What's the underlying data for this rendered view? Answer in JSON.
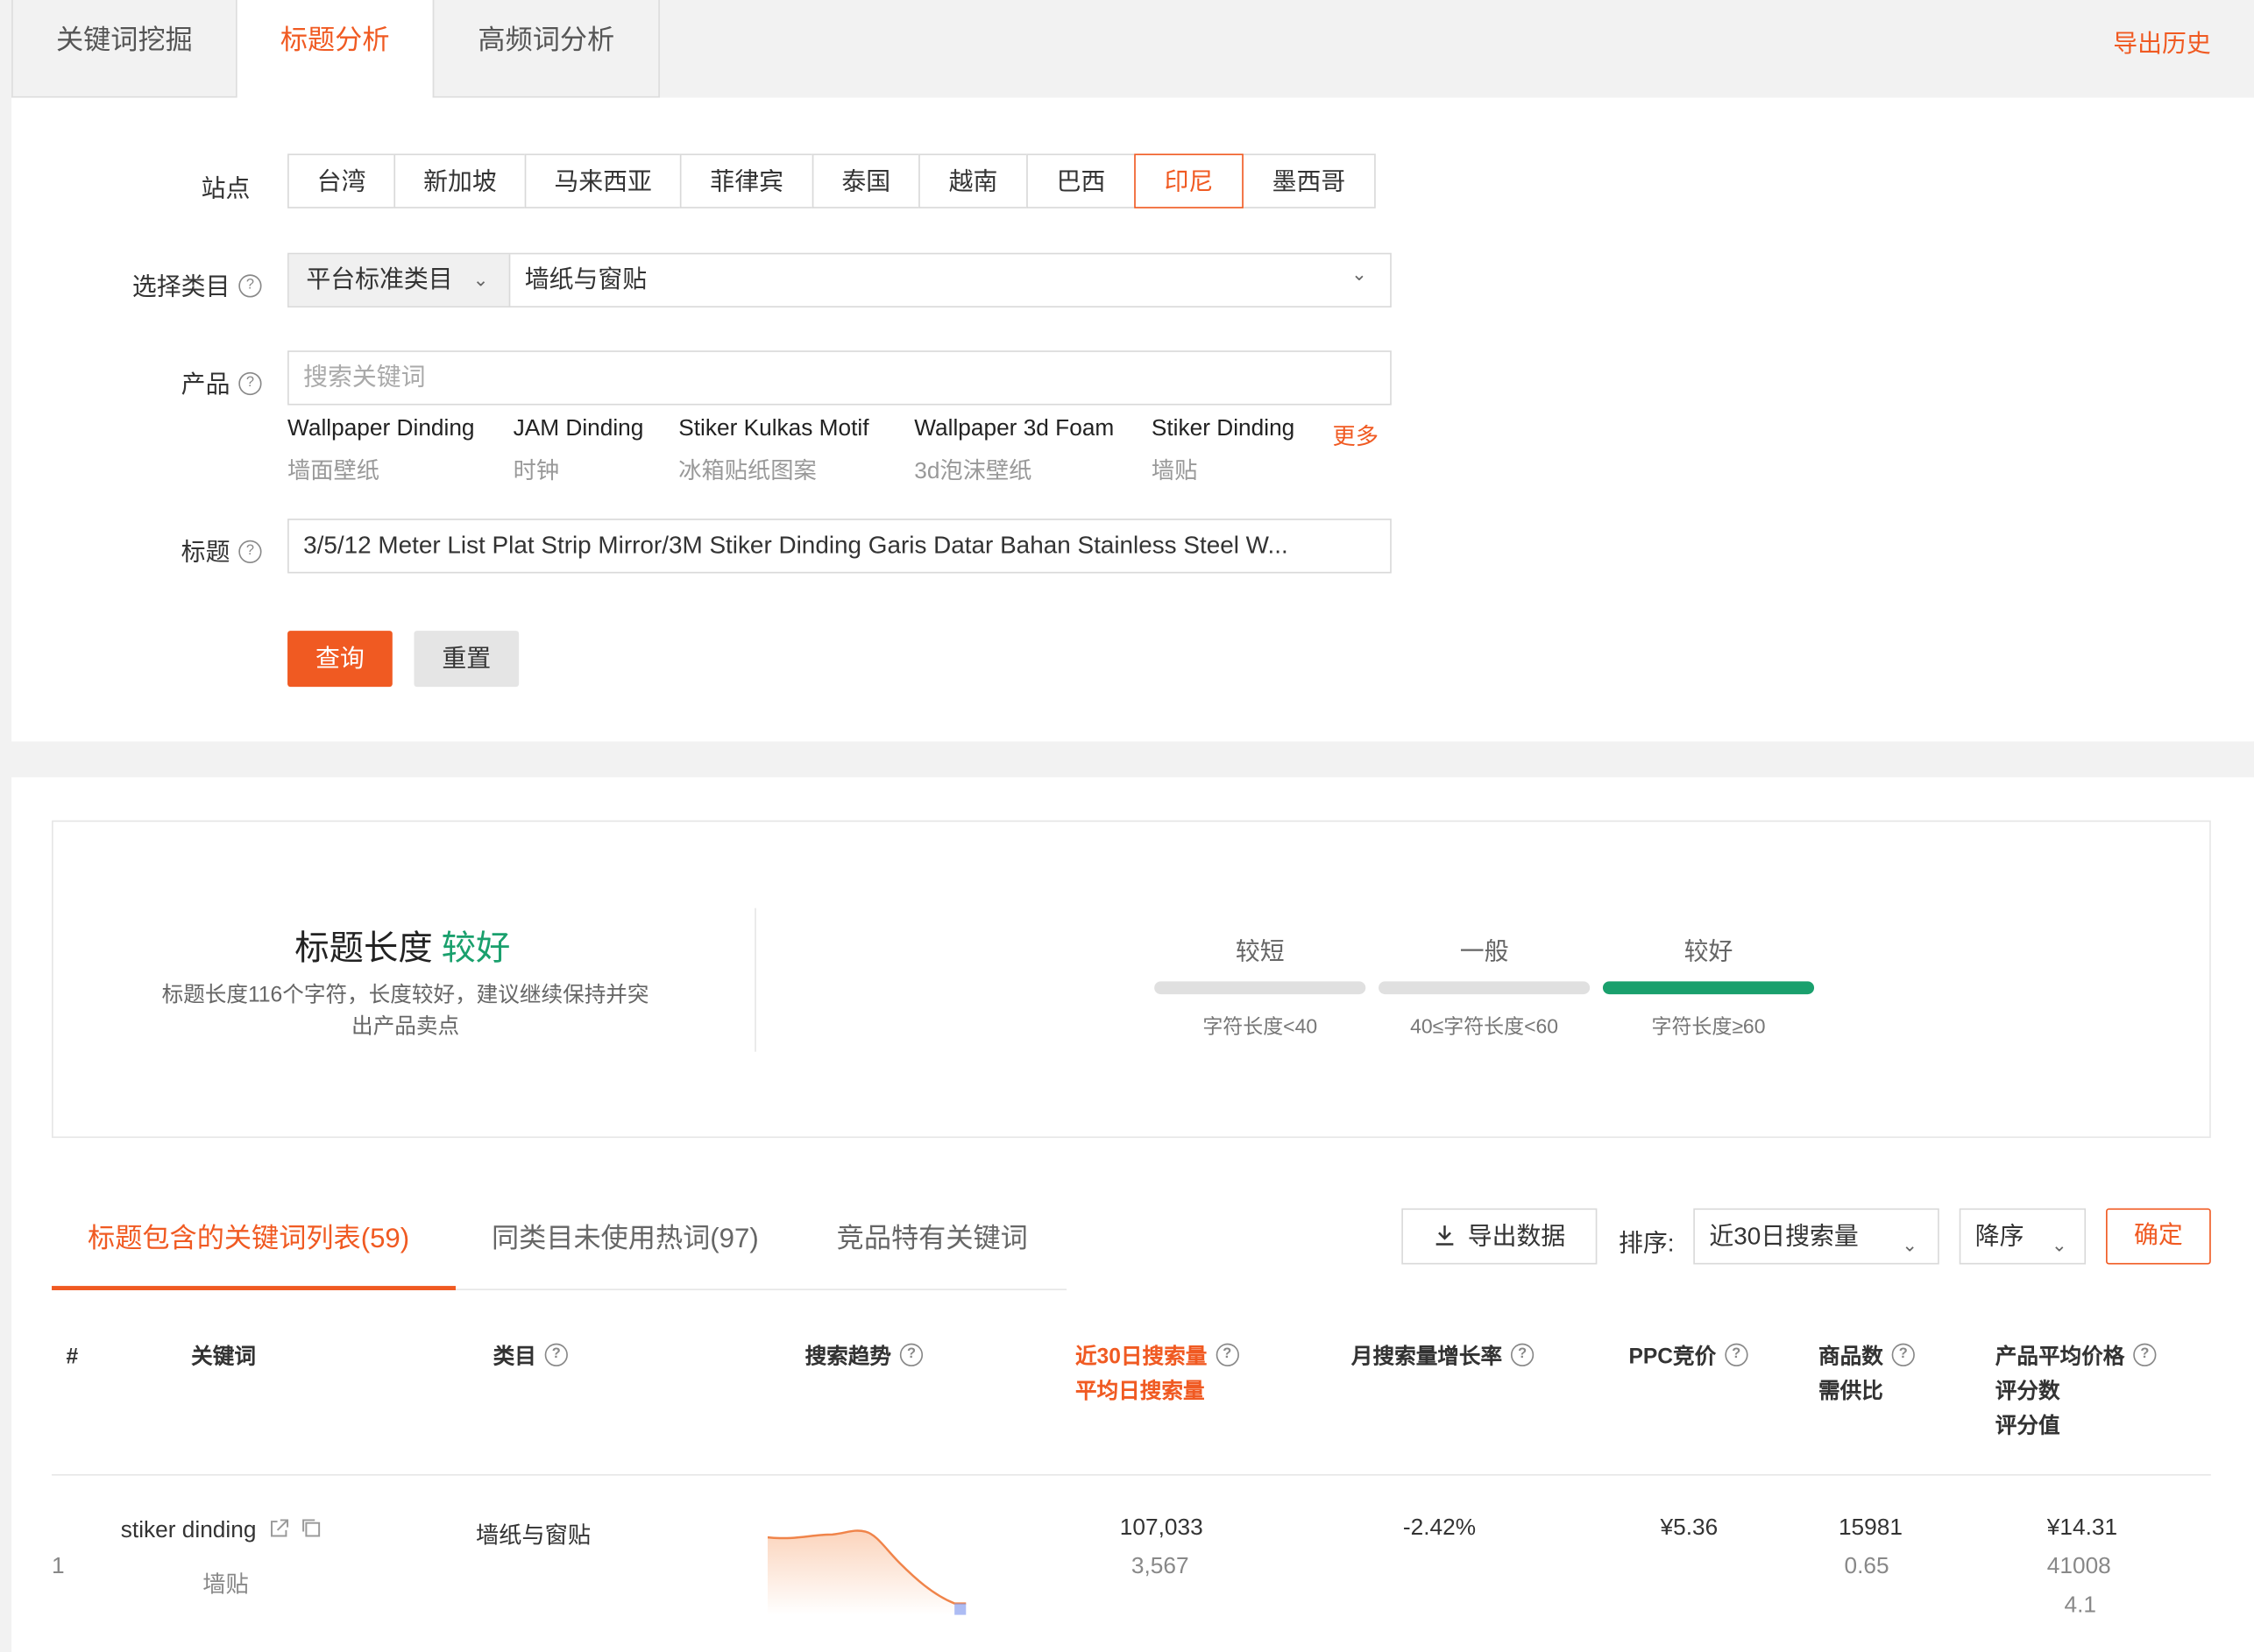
{
  "top_tabs": [
    {
      "label": "关键词挖掘"
    },
    {
      "label": "标题分析"
    },
    {
      "label": "高频词分析"
    }
  ],
  "export_history": "导出历史",
  "form": {
    "site_label": "站点",
    "sites": [
      "台湾",
      "新加坡",
      "马来西亚",
      "菲律宾",
      "泰国",
      "越南",
      "巴西",
      "印尼",
      "墨西哥"
    ],
    "active_site": "印尼",
    "category_label": "选择类目",
    "category_type": "平台标准类目",
    "category_value": "墙纸与窗贴",
    "product_label": "产品",
    "product_placeholder": "搜索关键词",
    "suggestions": [
      {
        "en": "Wallpaper Dinding",
        "cn": "墙面壁纸"
      },
      {
        "en": "JAM Dinding",
        "cn": "时钟"
      },
      {
        "en": "Stiker Kulkas Motif",
        "cn": "冰箱贴纸图案"
      },
      {
        "en": "Wallpaper 3d Foam",
        "cn": "3d泡沫壁纸"
      },
      {
        "en": "Stiker Dinding",
        "cn": "墙贴"
      }
    ],
    "more_label": "更多",
    "title_label": "标题",
    "title_value": "3/5/12 Meter List Plat Strip Mirror/3M Stiker Dinding Garis Datar Bahan Stainless Steel W...",
    "query_button": "查询",
    "reset_button": "重置"
  },
  "title_length": {
    "heading": "标题长度",
    "rating": "较好",
    "description": "标题长度116个字符，长度较好，建议继续保持并突出产品卖点",
    "segments": [
      {
        "title": "较短",
        "range": "字符长度<40",
        "active": false
      },
      {
        "title": "一般",
        "range": "40≤字符长度<60",
        "active": false
      },
      {
        "title": "较好",
        "range": "字符长度≥60",
        "active": true
      }
    ],
    "accent_color": "#1aa06d"
  },
  "sub_tabs": [
    {
      "label": "标题包含的关键词列表(59)"
    },
    {
      "label": "同类目未使用热词(97)"
    },
    {
      "label": "竞品特有关键词"
    }
  ],
  "toolbar": {
    "export_data": "导出数据",
    "sort_label": "排序:",
    "sort_field": "近30日搜索量",
    "sort_order": "降序",
    "confirm": "确定"
  },
  "table": {
    "headers": {
      "index": "#",
      "keyword": "关键词",
      "category": "类目",
      "trend": "搜索趋势",
      "search30": "近30日搜索量",
      "avg_daily": "平均日搜索量",
      "growth": "月搜索量增长率",
      "ppc": "PPC竞价",
      "items": "商品数",
      "supply_ratio": "需供比",
      "avg_price": "产品平均价格",
      "rating_count": "评分数",
      "rating_value": "评分值"
    },
    "rows": [
      {
        "index": "1",
        "keyword": "stiker dinding",
        "keyword_cn": "墙贴",
        "category": "墙纸与窗贴",
        "search30": "107,033",
        "avg_daily": "3,567",
        "growth": "-2.42%",
        "ppc": "¥5.36",
        "items": "15981",
        "supply_ratio": "0.65",
        "avg_price": "¥14.31",
        "rating_count": "41008",
        "rating_value": "4.1"
      }
    ]
  },
  "colors": {
    "accent": "#f05a22",
    "good": "#1aa06d"
  }
}
